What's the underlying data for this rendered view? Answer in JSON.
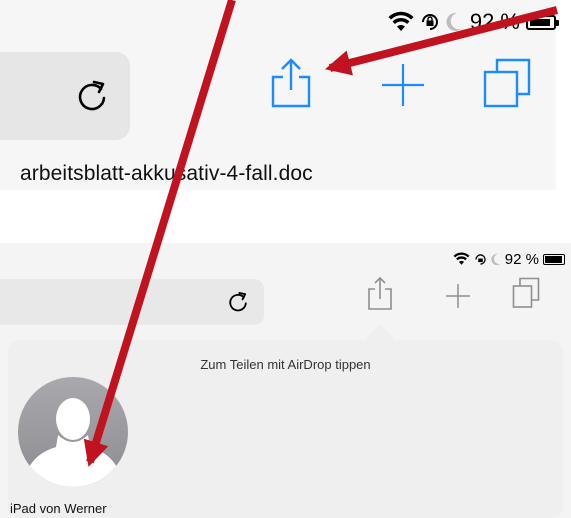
{
  "top": {
    "status": {
      "battery_percent": "92 %"
    },
    "filename": "arbeitsblatt-akkusativ-4-fall.doc"
  },
  "bottom": {
    "status": {
      "battery_percent": "92 %"
    },
    "airdrop_hint": "Zum Teilen mit AirDrop tippen",
    "device_name": "iPad von Werner"
  },
  "icons": {
    "wifi": "wifi-icon",
    "orientation_lock": "orientation-lock-icon",
    "moon": "moon-icon",
    "battery": "battery-icon",
    "reload": "reload-icon",
    "share": "share-icon",
    "plus": "new-tab-icon",
    "tabs": "tabs-icon",
    "avatar": "person-avatar-icon"
  },
  "colors": {
    "accent": "#1a8cff",
    "annotation_arrow": "#c1121f",
    "icon_gray": "#8e8e93"
  }
}
